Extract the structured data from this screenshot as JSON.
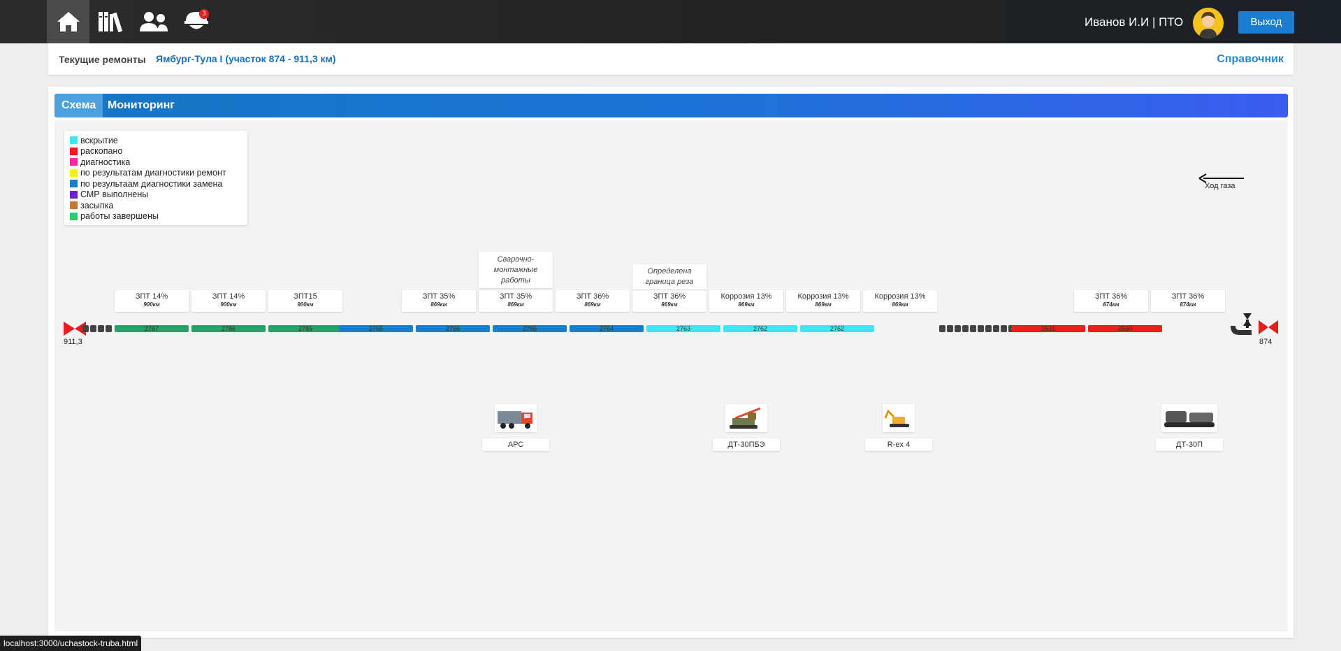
{
  "nav": {
    "items": [
      {
        "name": "home-icon"
      },
      {
        "name": "library-icon"
      },
      {
        "name": "users-icon"
      },
      {
        "name": "worker-helmet-icon"
      }
    ],
    "badge_count": "3",
    "user": "Иванов И.И | ПТО",
    "logout_label": "Выход"
  },
  "breadcrumb": {
    "label": "Текущие ремонты",
    "link": "Ямбург-Тула I (участок 874 - 911,3 км)",
    "reference": "Справочник"
  },
  "tabs": [
    {
      "label": "Схема",
      "active": true
    },
    {
      "label": "Мониторинг",
      "active": false
    }
  ],
  "legend": [
    {
      "label": "вскрытие",
      "color": "#3fe6f0"
    },
    {
      "label": "раскопано",
      "color": "#ee1c1c"
    },
    {
      "label": "диагностика",
      "color": "#ff2aa0"
    },
    {
      "label": "по результатам диагностики ремонт",
      "color": "#f5ef1a"
    },
    {
      "label": "по результаам диагностики замена",
      "color": "#1b7ec8"
    },
    {
      "label": "СМР выполнены",
      "color": "#6a22c9"
    },
    {
      "label": "засыпка",
      "color": "#c8782c"
    },
    {
      "label": "работы завершены",
      "color": "#2ecc6a"
    }
  ],
  "gas_direction": "Ход газа",
  "km_start": "911,3",
  "km_end": "874",
  "segments": [
    {
      "id": "2787",
      "color": "#2c9e6a",
      "label": "ЗПТ 14%",
      "km": "900км"
    },
    {
      "id": "2786",
      "color": "#2c9e6a",
      "label": "ЗПТ 14%",
      "km": "900км"
    },
    {
      "id": "2785",
      "color": "#2c9e6a",
      "label": "ЗПТ15",
      "km": "900км"
    },
    {
      "id": "2765",
      "color": "#1b7ec8",
      "label": "ЗПТ 35%",
      "km": "869км"
    },
    {
      "id": "2766",
      "color": "#1b7ec8",
      "label": "ЗПТ 35%",
      "km": "869км"
    },
    {
      "id": "2765",
      "color": "#1b7ec8",
      "label": "ЗПТ 36%",
      "km": "869км"
    },
    {
      "id": "2764",
      "color": "#1b7ec8",
      "label": "ЗПТ 36%",
      "km": "869км"
    },
    {
      "id": "2763",
      "color": "#3fe6f0",
      "label": "Коррозия 13%",
      "km": "869км"
    },
    {
      "id": "2762",
      "color": "#3fe6f0",
      "label": "Коррозия 13%",
      "km": "869км"
    },
    {
      "id": "2762",
      "color": "#3fe6f0",
      "label": "Коррозия 13%",
      "km": "869км"
    },
    {
      "id": "2531",
      "color": "#ee1c1c",
      "label": "ЗПТ 36%",
      "km": "874км"
    },
    {
      "id": "2530",
      "color": "#ee1c1c",
      "label": "ЗПТ 36%",
      "km": "874км"
    }
  ],
  "notes": [
    {
      "text": "Сварочно-монтажные работы"
    },
    {
      "text": "Определена граница реза"
    }
  ],
  "equipment": [
    {
      "label": "АРС"
    },
    {
      "label": "ДТ-30ПБЭ"
    },
    {
      "label": "R-ex 4"
    },
    {
      "label": "ДТ-30П"
    }
  ],
  "status_url": "localhost:3000/uchastock-truba.html"
}
